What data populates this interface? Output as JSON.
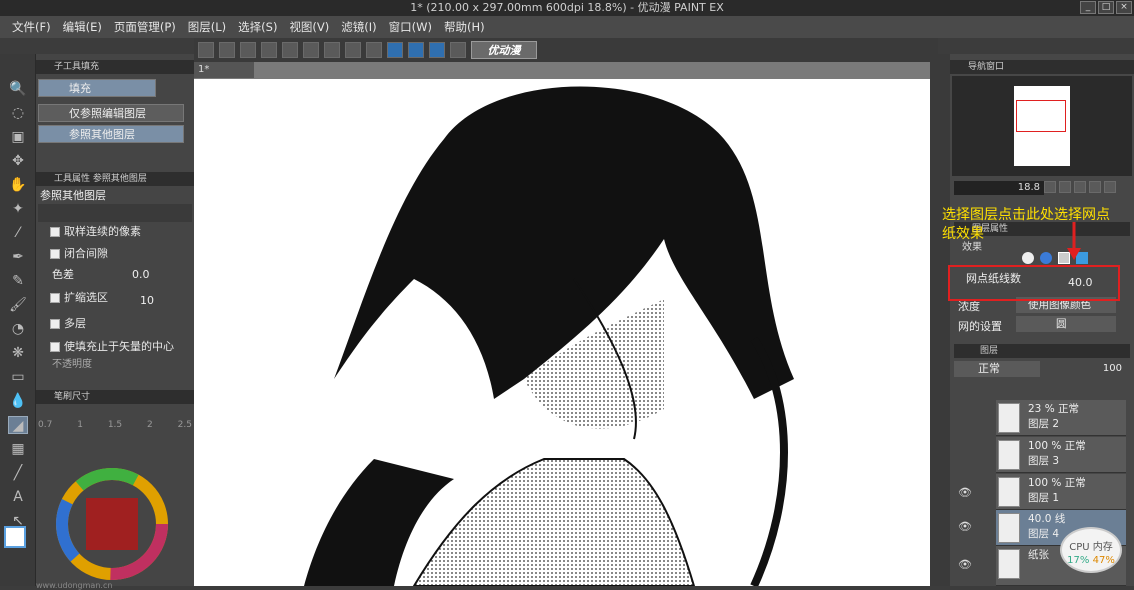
{
  "window": {
    "title": "1* (210.00 x 297.00mm 600dpi 18.8%) - 优动漫 PAINT EX"
  },
  "menu": [
    "文件(F)",
    "编辑(E)",
    "页面管理(P)",
    "图层(L)",
    "选择(S)",
    "视图(V)",
    "滤镜(I)",
    "窗口(W)",
    "帮助(H)"
  ],
  "toolbar": {
    "logo": "优动漫"
  },
  "document": {
    "tab": "1*"
  },
  "subtool": {
    "header": "子工具填充",
    "title": "填充",
    "items": [
      "仅参照编辑图层",
      "参照其他图层"
    ]
  },
  "toolprops": {
    "header": "工具属性 参照其他图层",
    "title": "参照其他图层",
    "options": [
      "取样连续的像素",
      "闭合间隙",
      "色差",
      "扩缩选区",
      "多层",
      "使填充止于矢量的中心",
      "不透明度"
    ],
    "tolerance": "0.0",
    "expand": "10"
  },
  "brushsize": {
    "header": "笔刷尺寸",
    "sizes": [
      "0.7",
      "1",
      "1.5",
      "2",
      "2.5"
    ]
  },
  "navigator": {
    "header": "导航窗口",
    "zoom": "18.8"
  },
  "annotation": {
    "text": "选择图层点击此处选择网点纸效果"
  },
  "layerprops": {
    "header": "图层属性",
    "effect_label": "效果",
    "screen_label": "网点纸线数",
    "screen_value": "40.0",
    "density_label": "浓度",
    "density_value": "使用图像颜色",
    "grid_label": "网的设置",
    "grid_value": "圆"
  },
  "layers": {
    "header": "图层",
    "blend": "正常",
    "opacity": "100",
    "items": [
      {
        "opacity": "23 % 正常",
        "name": "图层 2"
      },
      {
        "opacity": "100 % 正常",
        "name": "图层 3"
      },
      {
        "opacity": "100 % 正常",
        "name": "图层 1"
      },
      {
        "opacity": "40.0 线",
        "name": "图层 4"
      },
      {
        "opacity": "",
        "name": "纸张"
      }
    ]
  },
  "cpu": {
    "label": "CPU 内存",
    "cpu_value": "17%",
    "mem_value": "47%"
  },
  "watermark": {
    "text": "www.udongman.cn"
  }
}
